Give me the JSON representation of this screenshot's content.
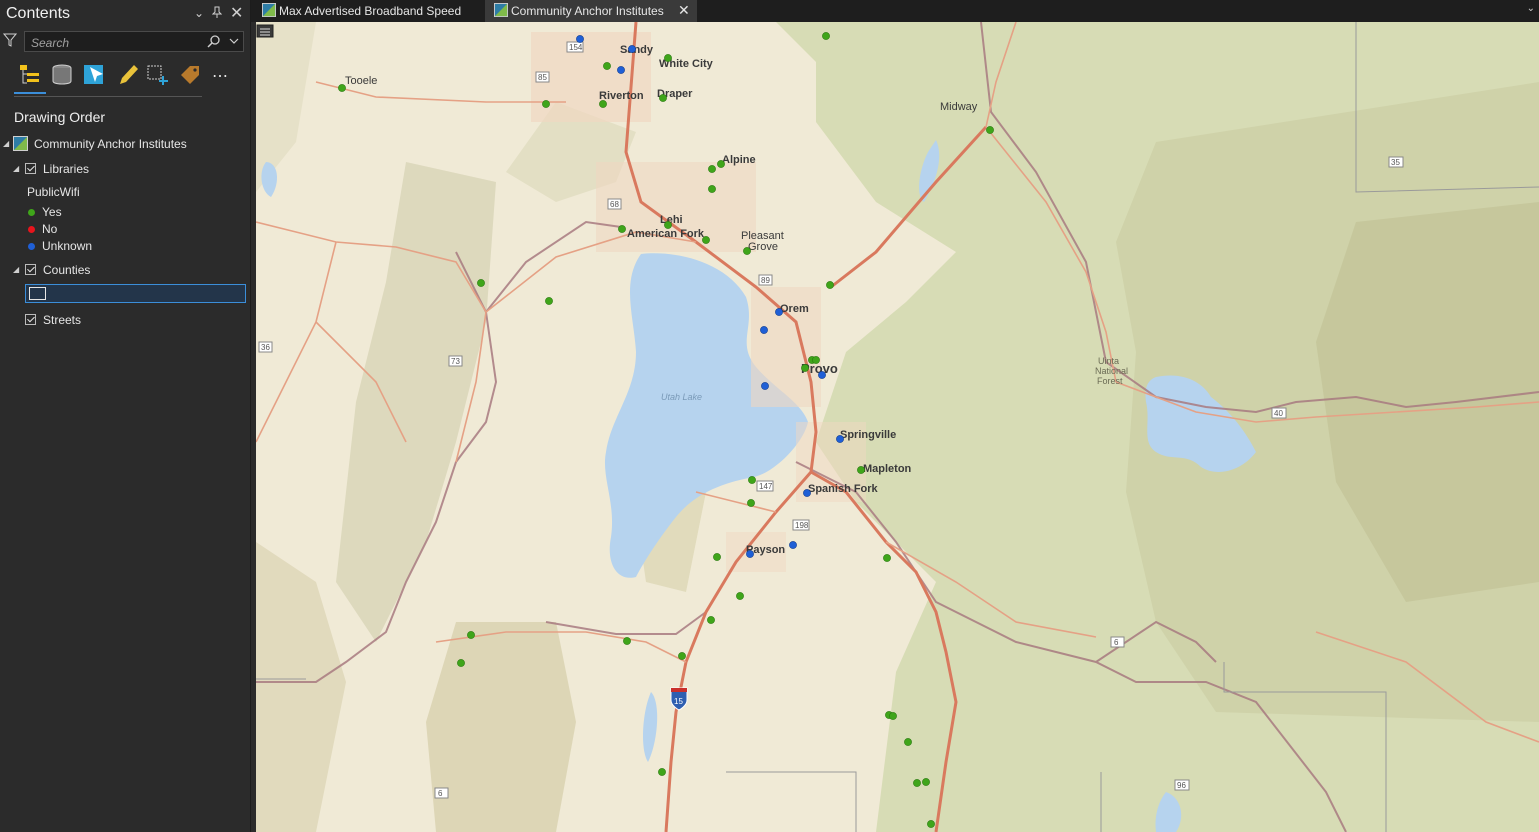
{
  "pane": {
    "title": "Contents",
    "search_placeholder": "Search",
    "section_title": "Drawing Order",
    "layers": {
      "map_name": "Community Anchor Institutes",
      "libraries": "Libraries",
      "legend_field": "PublicWifi",
      "legend": [
        {
          "label": "Yes",
          "color": "#3fa51a"
        },
        {
          "label": "No",
          "color": "#e8141c"
        },
        {
          "label": "Unknown",
          "color": "#1f5fd6"
        }
      ],
      "counties": "Counties",
      "streets": "Streets"
    },
    "header_icons": [
      "chevron-down-icon",
      "pin-icon",
      "close-icon"
    ],
    "toolbar_icons": [
      "list-by-drawing-order-icon",
      "list-by-source-icon",
      "list-by-selection-icon",
      "list-by-editing-icon",
      "list-by-snapping-icon",
      "list-by-labeling-icon",
      "more-icon"
    ]
  },
  "tabs": [
    {
      "label": "Max Advertised Broadband Speed",
      "active": false
    },
    {
      "label": "Community Anchor Institutes",
      "active": true
    }
  ],
  "map": {
    "places": [
      "Tooele",
      "Sandy",
      "White City",
      "Riverton",
      "Draper",
      "Midway",
      "Alpine",
      "Lehi",
      "American Fork",
      "Pleasant",
      "Grove",
      "Orem",
      "Provo",
      "Utah Lake",
      "Springville",
      "Mapleton",
      "Spanish Fork",
      "Payson",
      "Uinta",
      "National",
      "Forest"
    ],
    "highways": [
      "154",
      "85",
      "68",
      "36",
      "73",
      "89",
      "147",
      "198",
      "6",
      "15",
      "35",
      "40",
      "96",
      "6"
    ]
  }
}
